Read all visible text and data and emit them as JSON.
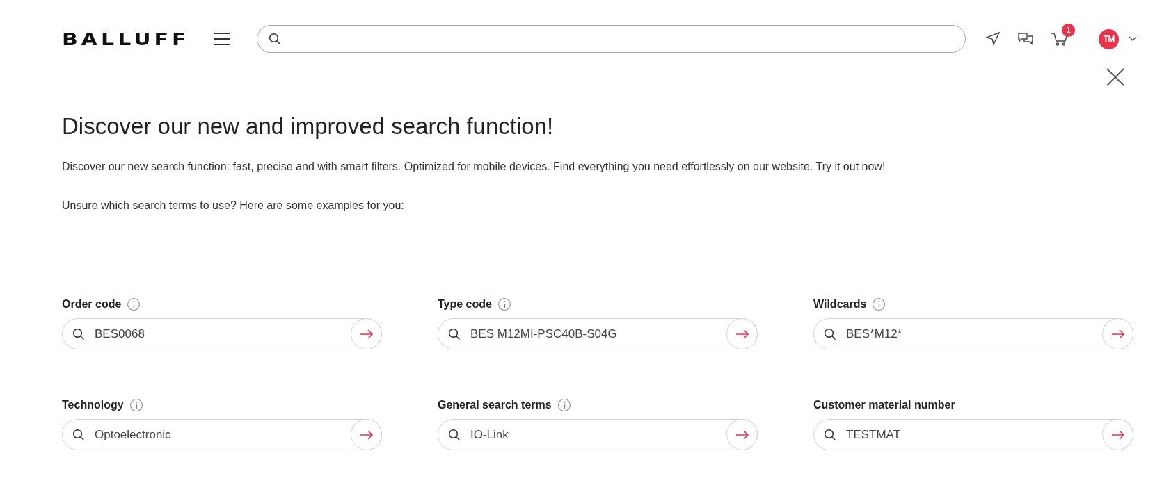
{
  "header": {
    "logo": "BALLUFF",
    "cart_count": "1",
    "avatar": "TM"
  },
  "dialog": {
    "title": "Discover our new and improved search function!",
    "intro": "Discover our new search function: fast, precise and with smart filters. Optimized for mobile devices. Find everything you need effortlessly on our website. Try it out now!",
    "prompt": "Unsure which search terms to use? Here are some examples for you:",
    "examples": [
      {
        "label": "Order code",
        "info": true,
        "value": "BES0068"
      },
      {
        "label": "Type code",
        "info": true,
        "value": "BES M12MI-PSC40B-S04G"
      },
      {
        "label": "Wildcards",
        "info": true,
        "value": "BES*M12*"
      },
      {
        "label": "Technology",
        "info": true,
        "value": "Optoelectronic"
      },
      {
        "label": "General search terms",
        "info": true,
        "value": "IO-Link"
      },
      {
        "label": "Customer material number",
        "info": false,
        "value": "TESTMAT"
      }
    ]
  }
}
